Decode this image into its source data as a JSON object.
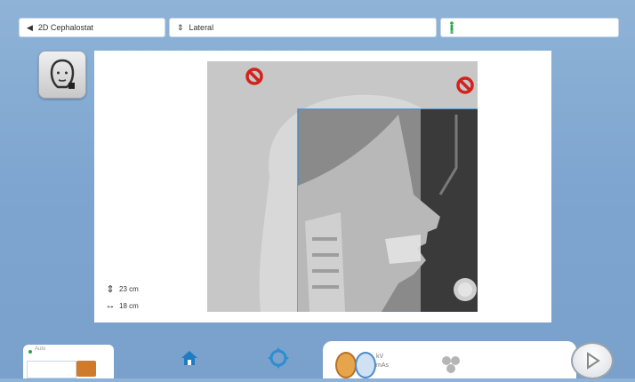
{
  "topbar": {
    "mode_label": "2D Cephalostat",
    "mode_icon": "chevron-left-icon",
    "projection_label": "Lateral",
    "projection_icon": "up-down-arrows-icon",
    "patient_icon": "standing-patient-icon"
  },
  "side_button": {
    "icon": "head-profile-icon"
  },
  "preview": {
    "measure_height": "23 cm",
    "measure_width": "18 cm",
    "block_icon": "prohibited-icon"
  },
  "bottombar": {
    "status_label": "Auto",
    "tabs": [
      "home",
      "position",
      "program",
      "settings"
    ],
    "kv_label": "kV",
    "mas_label": "mAs"
  },
  "colors": {
    "background": "#8fb3d7",
    "accent_blue": "#2c8ed1",
    "prohibited_red": "#d2221b",
    "patient_green": "#29a745"
  }
}
